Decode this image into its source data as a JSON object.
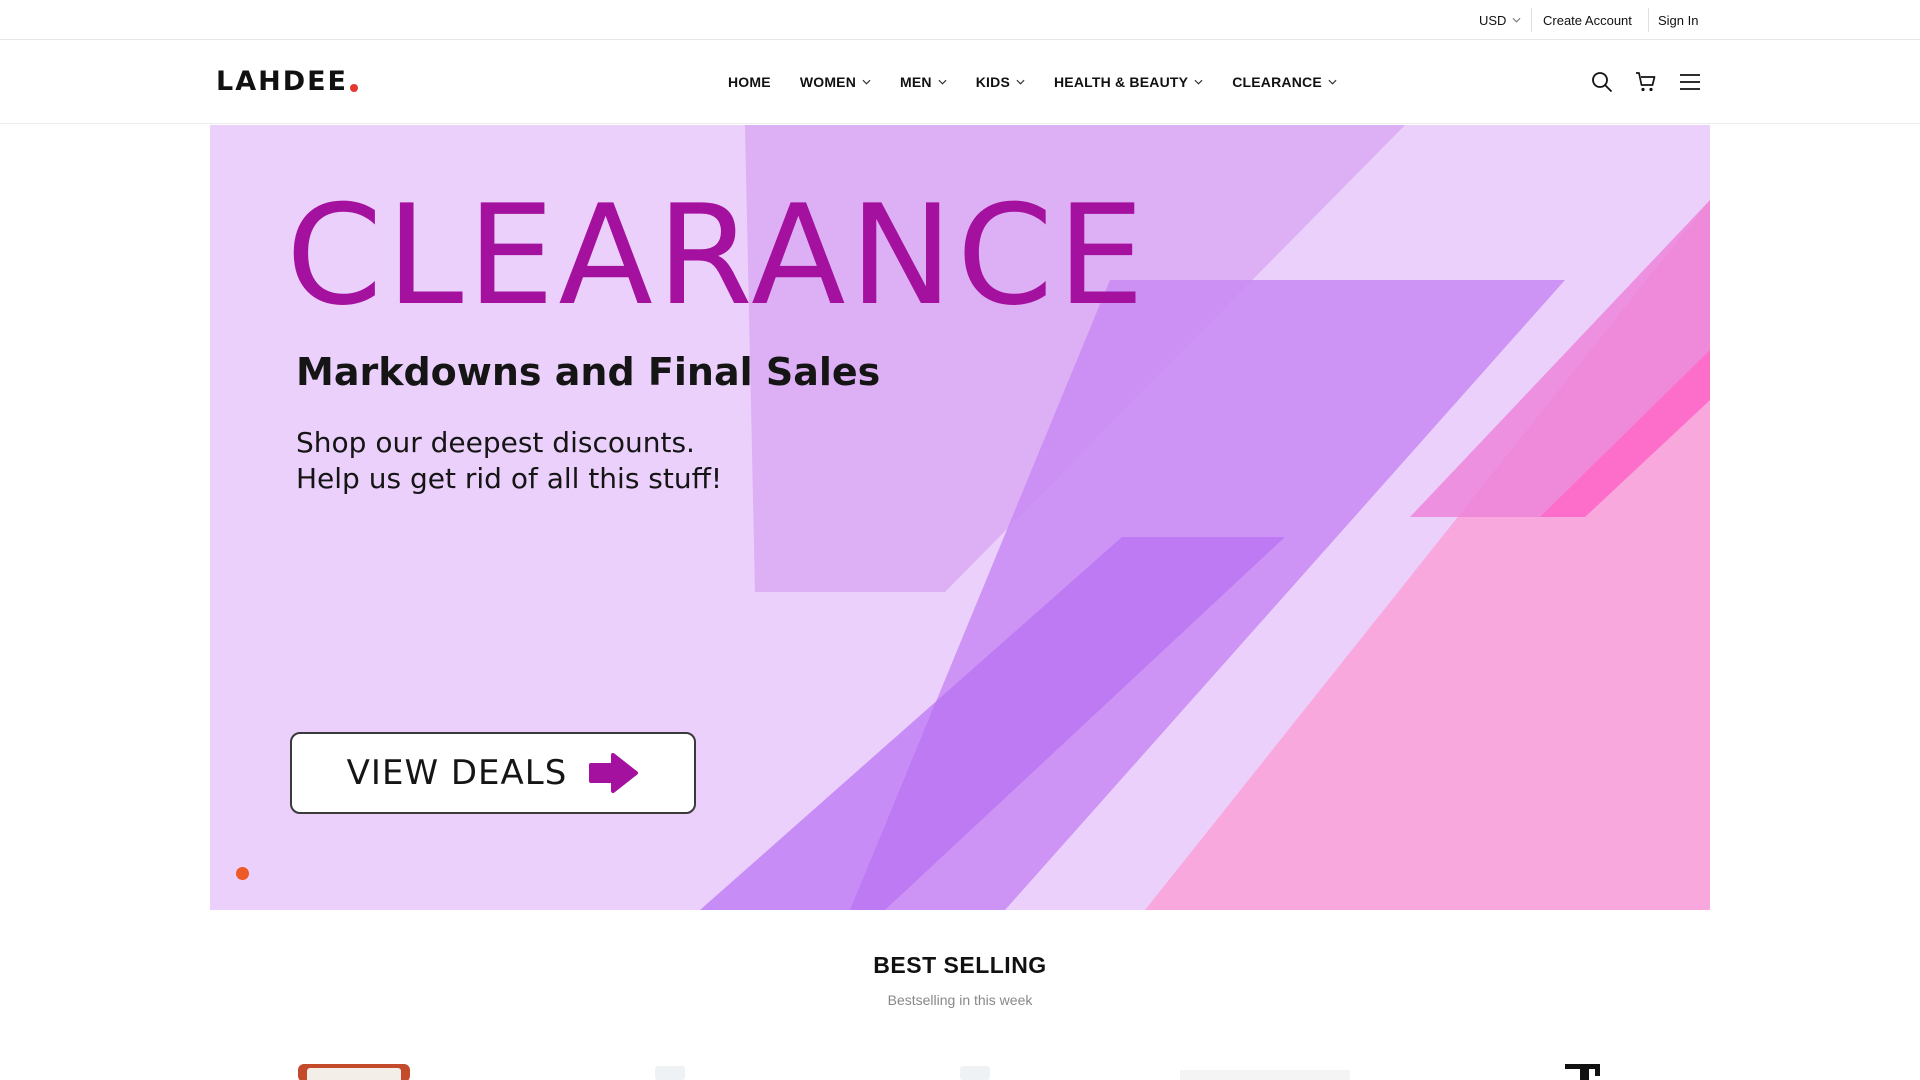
{
  "utility": {
    "currency": "USD",
    "create_account": "Create Account",
    "sign_in": "Sign In"
  },
  "header": {
    "logo": "LAHDEE",
    "logo_dot_color": "#e3382b",
    "nav": [
      {
        "label": "HOME",
        "dropdown": false
      },
      {
        "label": "WOMEN",
        "dropdown": true
      },
      {
        "label": "MEN",
        "dropdown": true
      },
      {
        "label": "KIDS",
        "dropdown": true
      },
      {
        "label": "HEALTH & BEAUTY",
        "dropdown": true
      },
      {
        "label": "CLEARANCE",
        "dropdown": true
      }
    ],
    "icons": [
      "search-icon",
      "cart-icon",
      "menu-icon"
    ]
  },
  "hero": {
    "title": "CLEARANCE",
    "subtitle": "Markdowns and Final Sales",
    "line1": "Shop our deepest discounts.",
    "line2": "Help us get rid of all this stuff!",
    "button_label": "VIEW DEALS",
    "title_color": "#a5119f",
    "background_color": "#ebd0fb",
    "slide_count": 1,
    "active_slide": 1
  },
  "best_selling": {
    "title": "BEST SELLING",
    "subtitle": "Bestselling in this week"
  }
}
